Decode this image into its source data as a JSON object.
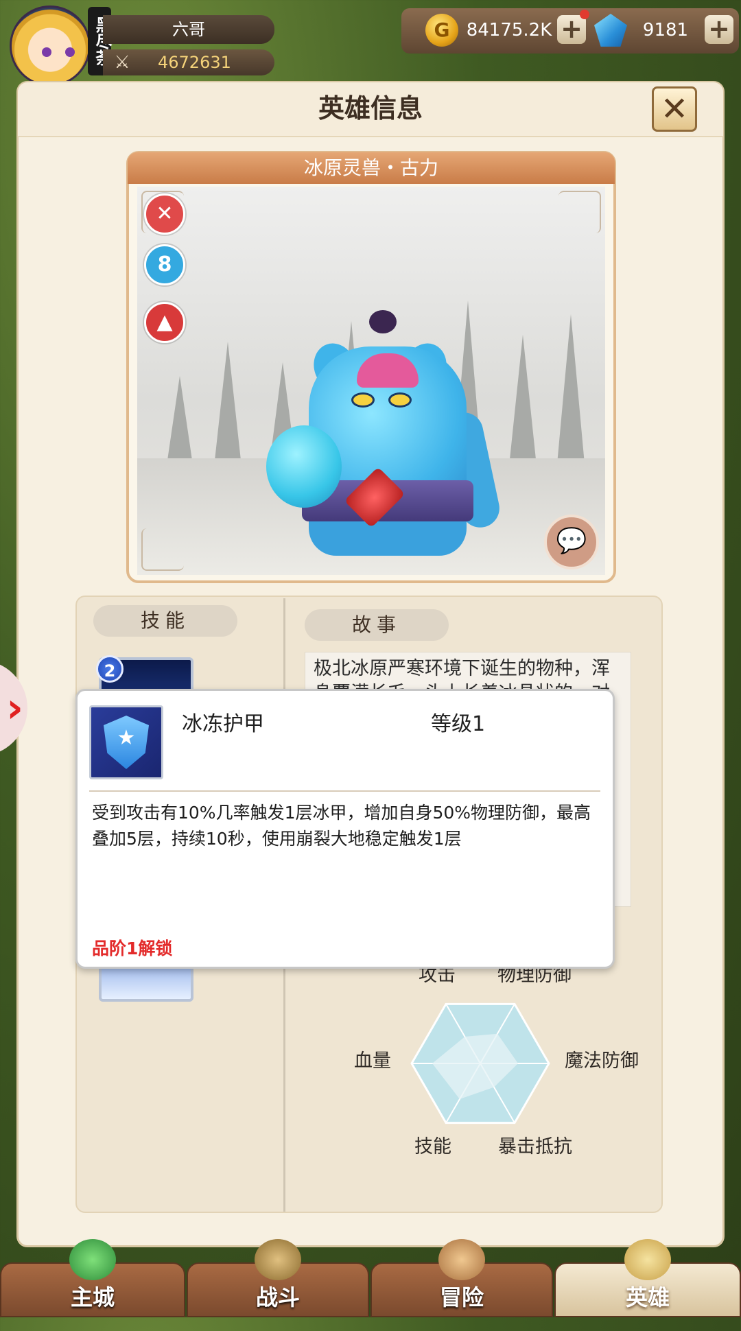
{
  "player": {
    "avatar_badge": "黑尽荼",
    "name": "六哥",
    "power": "4672631"
  },
  "currency": {
    "gold": "84175.2K",
    "gems": "9181"
  },
  "panel": {
    "title": "英雄信息"
  },
  "hero": {
    "name": "冰原灵兽・古力",
    "traits": [
      {
        "icon": "axe-icon",
        "color": "#e04a4a"
      },
      {
        "icon": "shield-rune-icon",
        "color": "#34a9e0"
      },
      {
        "icon": "rocket-icon",
        "color": "#d83a3a"
      }
    ]
  },
  "tabs": {
    "skills": "技能",
    "story": "故事"
  },
  "skills": {
    "level_badge": "2"
  },
  "story": {
    "text": "极北冰原严寒环境下诞生的物种，浑身覆满长毛，头上长着冰晶状的一对犄角，喉咙上有冰雪凝结的护甲，能在极寒的环境中凝结出坚硬的护甲，一天空之下，着冰霜而冰晶构成的巨大手臂……"
  },
  "radar": {
    "labels": {
      "top_left": "攻击",
      "top_right": "物理防御",
      "left": "血量",
      "right": "魔法防御",
      "bottom_left": "技能",
      "bottom_right": "暴击抵抗"
    },
    "values": [
      0.45,
      0.5,
      0.55,
      0.4,
      0.6,
      0.7
    ]
  },
  "tooltip": {
    "skill_name": "冰冻护甲",
    "level": "等级1",
    "description": "受到攻击有10%几率触发1层冰甲，增加自身50%物理防御，最高叠加5层，持续10秒，使用崩裂大地稳定触发1层",
    "unlock": "品阶1解锁"
  },
  "nav": {
    "items": [
      {
        "label": "主城",
        "active": false
      },
      {
        "label": "战斗",
        "active": false
      },
      {
        "label": "冒险",
        "active": false
      },
      {
        "label": "英雄",
        "active": true
      }
    ]
  },
  "colors": {
    "accent_title_bar": "#d48a57",
    "unlock_red": "#e32a2a",
    "radar_fill": "#bfe3ea"
  }
}
